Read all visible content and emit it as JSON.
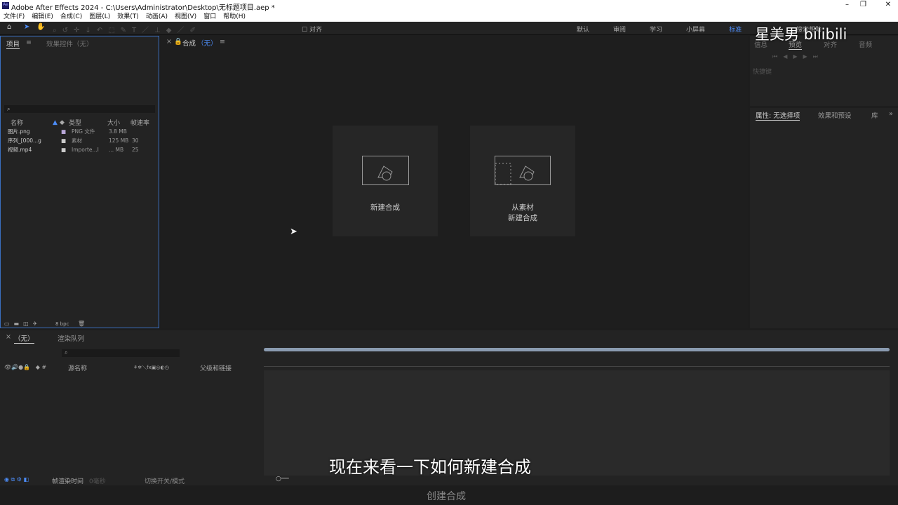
{
  "window": {
    "title": "Adobe After Effects 2024 - C:\\Users\\Administrator\\Desktop\\无标题项目.aep *",
    "app_icon": "Ae"
  },
  "menu": [
    "文件(F)",
    "编辑(E)",
    "合成(C)",
    "图层(L)",
    "效果(T)",
    "动画(A)",
    "视图(V)",
    "窗口",
    "帮助(H)"
  ],
  "toolbar": {
    "align": "对齐"
  },
  "workspaces": {
    "items": [
      "默认",
      "审阅",
      "学习",
      "小屏幕",
      "标准"
    ],
    "active": "标准",
    "search": "搜索帮助"
  },
  "project": {
    "tab": "项目",
    "tab2": "效果控件（无）",
    "columns": [
      "名称",
      "类型",
      "大小",
      "帧速率"
    ],
    "items": [
      {
        "name": "图片.png",
        "type": "PNG 文件",
        "size": "3.8 MB",
        "fps": ""
      },
      {
        "name": "序列_[000...g",
        "type": "素材",
        "size": "125 MB",
        "fps": "30"
      },
      {
        "name": "视频.mp4",
        "type": "Importe...I",
        "size": "... MB",
        "fps": "25"
      }
    ],
    "bpc": "8 bpc"
  },
  "comp": {
    "tab": "合成",
    "tab_sub": "（无）",
    "new_comp": "新建合成",
    "from_footage_1": "从素材",
    "from_footage_2": "新建合成"
  },
  "right": {
    "tabs": [
      "信息",
      "预览",
      "对齐",
      "音频"
    ],
    "shortcut": "快捷键",
    "props": "属性: 无选择项",
    "effects": "效果和预设",
    "lib": "库"
  },
  "timeline": {
    "tab": "（无）",
    "render_queue": "渲染队列",
    "source_name": "源名称",
    "parent": "父级和链接",
    "render_time": "帧渲染时间",
    "render_value": "0毫秒",
    "toggle": "切换开关/模式"
  },
  "overlay": {
    "watermark": "星美男 bilibili",
    "subtitle": "现在来看一下如何新建合成",
    "caption": "创建合成"
  }
}
